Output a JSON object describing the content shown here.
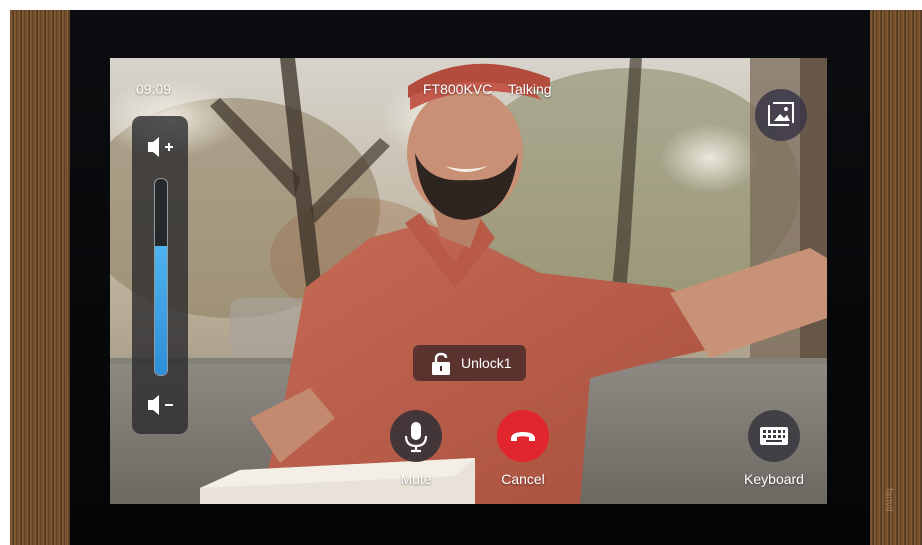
{
  "status_bar": {
    "time": "09:09",
    "device_id": "FT800KVC",
    "call_status": "Talking"
  },
  "unlock": {
    "label": "Unlock1"
  },
  "controls": {
    "mute_label": "Mute",
    "cancel_label": "Cancel",
    "keyboard_label": "Keyboard"
  },
  "volume": {
    "level_fraction": 0.66
  },
  "brand": "fanvil",
  "colors": {
    "cancel_red": "#e2262e",
    "mute_bg": "#3a3338",
    "volume_fill": "#3aa0e6",
    "unlock_bg": "#462a28"
  },
  "icons": [
    "volume-up-icon",
    "volume-down-icon",
    "image-capture-icon",
    "unlock-icon",
    "microphone-icon",
    "hang-up-icon",
    "keyboard-icon"
  ]
}
